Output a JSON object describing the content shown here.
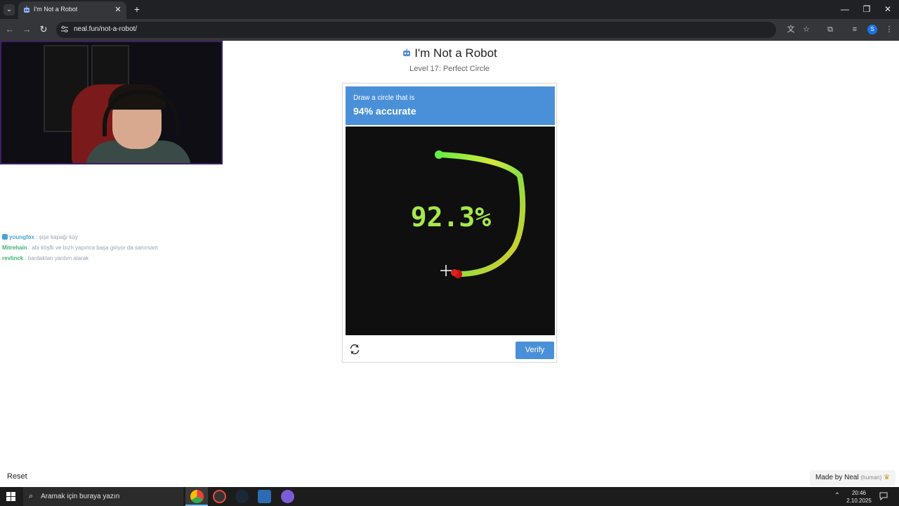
{
  "browser": {
    "tab_title": "I'm Not a Robot",
    "url": "neal.fun/not-a-robot/",
    "profile_initial": "S",
    "window_controls": {
      "minimize": "—",
      "restore": "❐",
      "close": "✕"
    },
    "new_tab": "+",
    "tab_close": "✕"
  },
  "chat": {
    "messages": [
      {
        "user": "youngfox",
        "text": " : şişe kapağı koy",
        "user_color": "#4aa3d8"
      },
      {
        "user": "Mitrehain",
        "text": " : abi köşfk ve bızh yapınca başa giriyor da sanırsam",
        "user_color": "#3cb371"
      },
      {
        "user": "revlinck",
        "text": " : bardaktan yardım alarak",
        "user_color": "#3cb371"
      }
    ]
  },
  "page": {
    "title": "I'm Not a Robot",
    "subtitle": "Level 17: Perfect Circle"
  },
  "captcha": {
    "prompt_line1": "Draw a circle that is",
    "prompt_line2": "94% accurate",
    "score": "92.3%",
    "verify_label": "Verify",
    "accent": "#4a90d9"
  },
  "footer": {
    "reset_label": "Reset",
    "made_by": "Made by Neal",
    "made_by_note": "(human)"
  },
  "taskbar": {
    "search_placeholder": "Aramak için buraya yazın",
    "time": "20:46",
    "date": "2.10.2025"
  }
}
